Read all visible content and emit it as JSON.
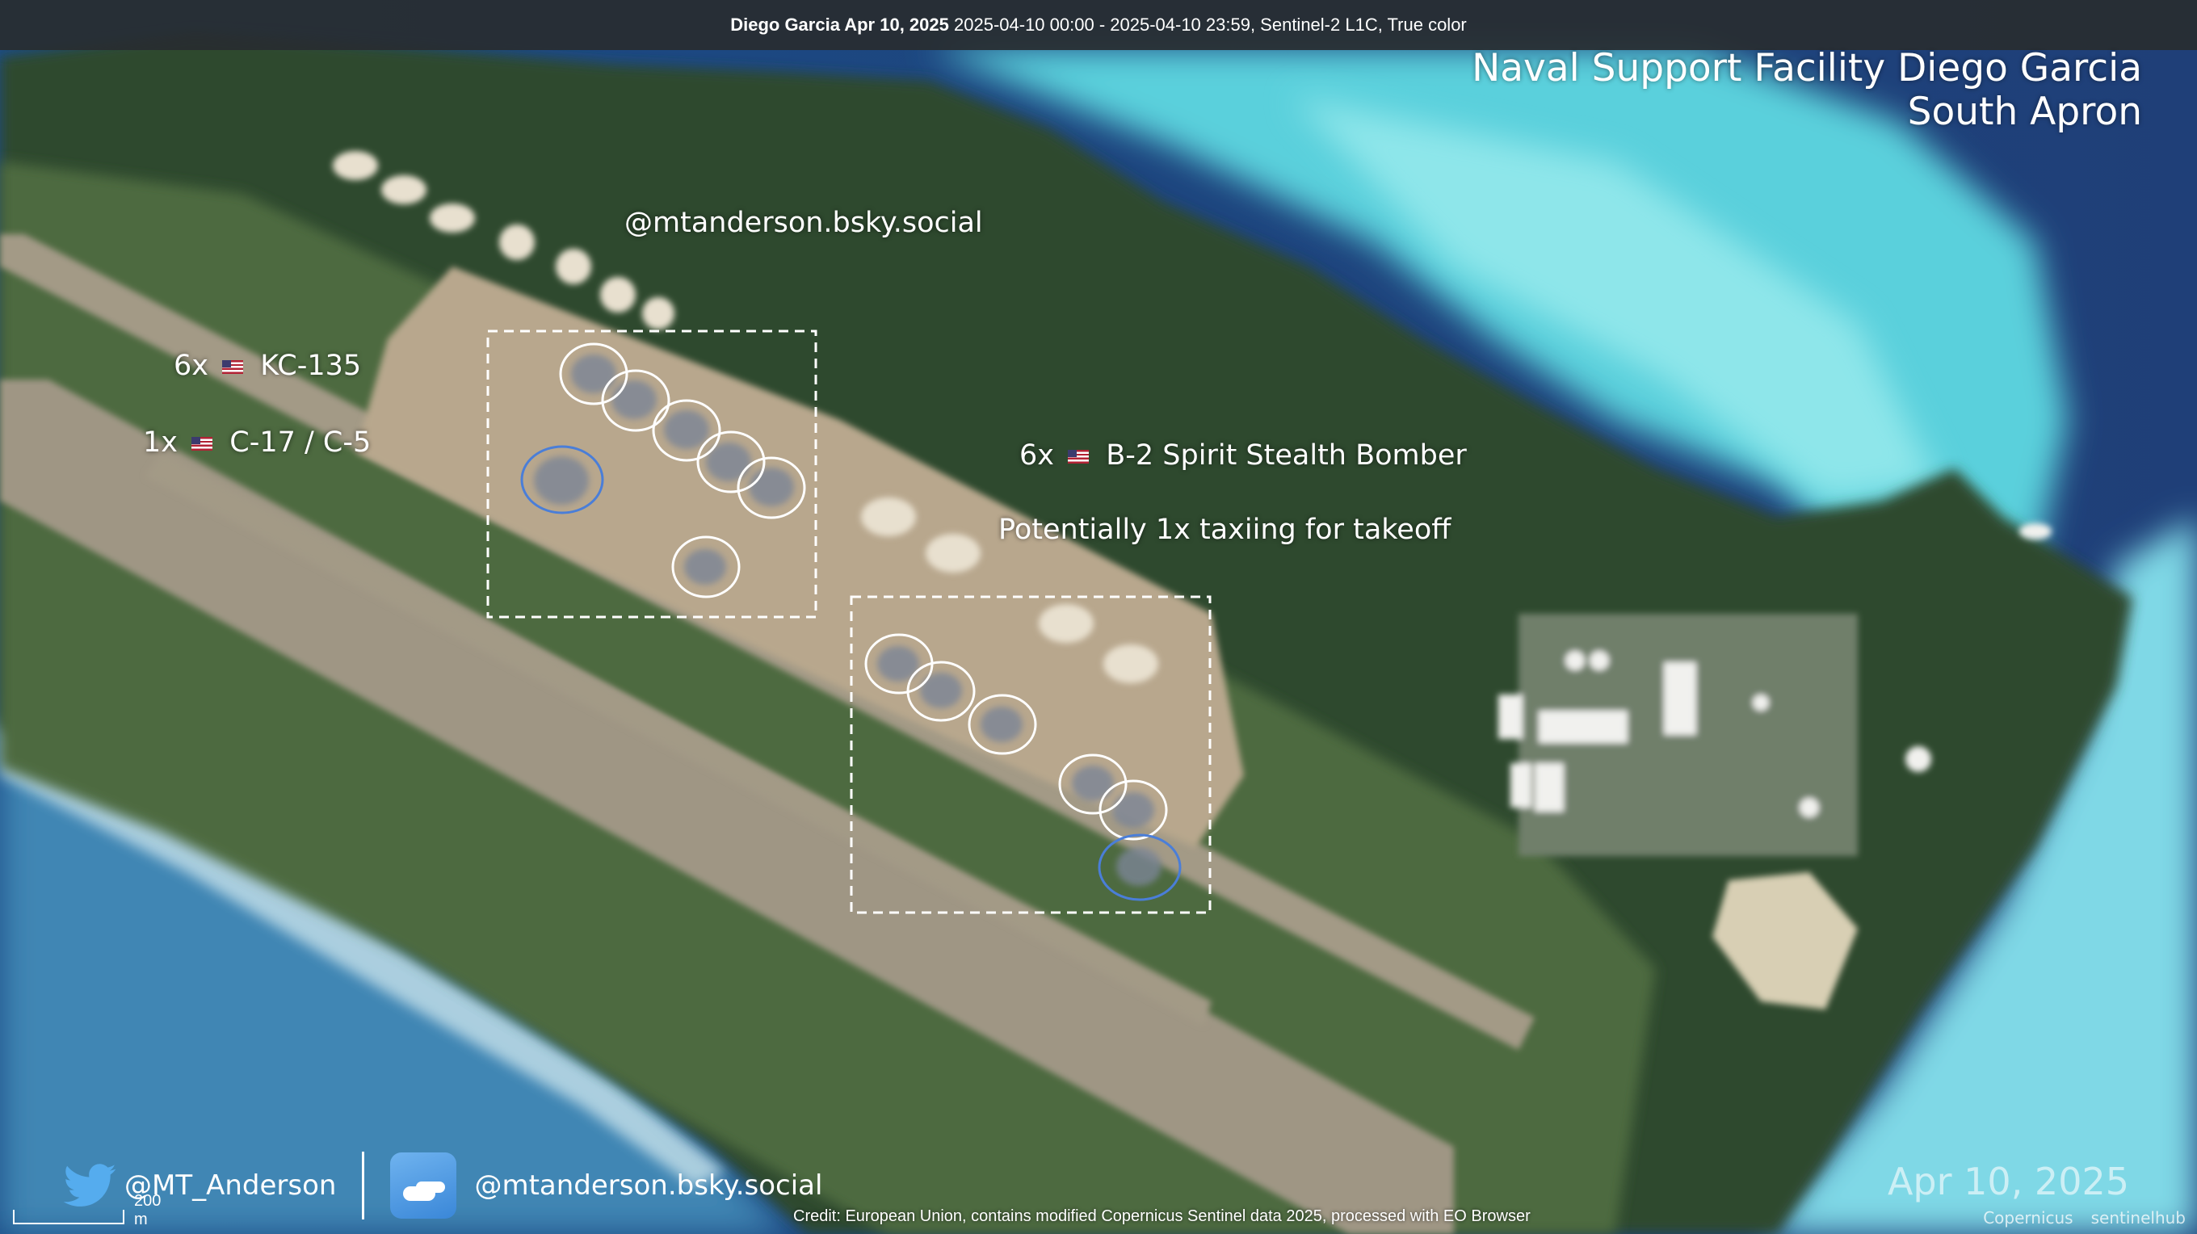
{
  "header": {
    "location_bold": "Diego Garcia Apr 10, 2025",
    "details": "2025-04-10 00:00 - 2025-04-10 23:59, Sentinel-2 L1C, True color"
  },
  "title": {
    "line1": "Naval Support Facility Diego Garcia",
    "line2": "South Apron"
  },
  "watermark_handle": "@mtanderson.bsky.social",
  "annotations": {
    "kc135_count": "6x",
    "kc135_type": "KC-135",
    "c17_count": "1x",
    "c17_type": "C-17 / C-5",
    "b2_count": "6x",
    "b2_type": "B-2 Spirit Stealth Bomber",
    "taxi_note": "Potentially 1x taxiing for takeoff"
  },
  "footer": {
    "twitter_handle": "@MT_Anderson",
    "bluesky_handle": "@mtanderson.bsky.social",
    "scale_label": "200 m",
    "credit": "Credit: European Union, contains modified Copernicus Sentinel data 2025, processed with EO Browser",
    "date": "Apr 10, 2025",
    "copernicus_logo": "Copernicus",
    "sentinelhub_logo": "sentinelhub"
  },
  "colors": {
    "ocean_deep": "#1d4f8a",
    "lagoon_turquoise": "#63d4de",
    "vegetation": "#2f4a2c",
    "apron": "#b9a98f",
    "circle_white": "#ffffff",
    "circle_blue": "#4a7ed8"
  }
}
